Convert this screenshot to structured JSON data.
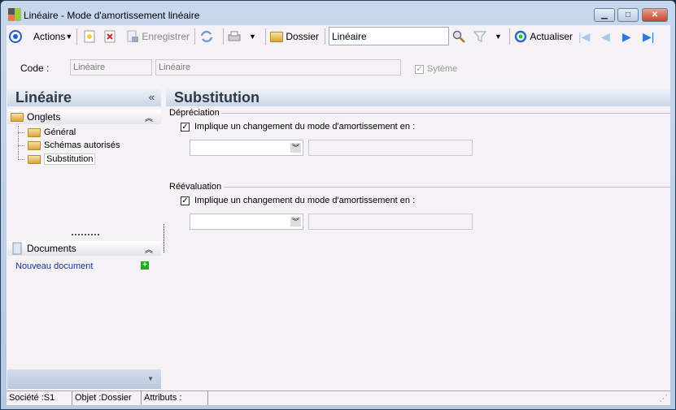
{
  "window": {
    "title": "Linéaire -  Mode d'amortissement linéaire",
    "minimize": "▁",
    "maximize": "□",
    "close": "✕"
  },
  "toolbar": {
    "actions": "Actions",
    "save": "Enregistrer",
    "dossier": "Dossier",
    "search_value": "Linéaire",
    "refresh": "Actualiser"
  },
  "code_row": {
    "label": "Code :",
    "code": "Linéaire",
    "description": "Linéaire",
    "system_label": "Sytème",
    "system_checked": true
  },
  "left_panel": {
    "title": "Linéaire",
    "collapse": "«",
    "tabs_group": "Onglets",
    "tabs": [
      "Général",
      "Schémas autorisés",
      "Substitution"
    ],
    "documents_group": "Documents",
    "new_document": "Nouveau document",
    "chevron_up": "⌃"
  },
  "main": {
    "title": "Substitution",
    "sections": [
      {
        "legend": "Dépréciation",
        "checkbox_label": "Implique un changement du mode d'amortissement en :",
        "checked": true,
        "combo_value": "",
        "text_value": ""
      },
      {
        "legend": "Réévaluation",
        "checkbox_label": "Implique un changement du mode d'amortissement en :",
        "checked": true,
        "combo_value": "",
        "text_value": ""
      }
    ]
  },
  "status": {
    "company": "Société :S1",
    "object": "Objet :Dossier",
    "attributes": "Attributs :"
  }
}
